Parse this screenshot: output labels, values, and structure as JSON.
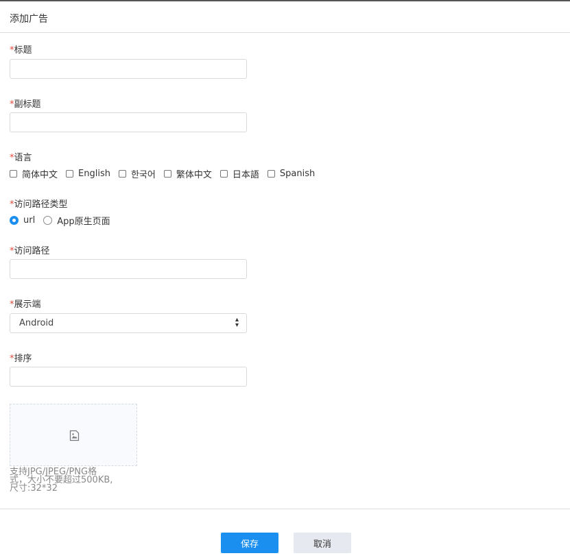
{
  "dialog": {
    "title": "添加广告"
  },
  "form": {
    "required_mark": "*",
    "title": {
      "label": "标题",
      "value": ""
    },
    "subtitle": {
      "label": "副标题",
      "value": ""
    },
    "language": {
      "label": "语言",
      "options": [
        {
          "label": "简体中文",
          "checked": false
        },
        {
          "label": "English",
          "checked": false
        },
        {
          "label": "한국어",
          "checked": false
        },
        {
          "label": "繁体中文",
          "checked": false
        },
        {
          "label": "日本語",
          "checked": false
        },
        {
          "label": "Spanish",
          "checked": false
        }
      ]
    },
    "path_type": {
      "label": "访问路径类型",
      "options": [
        {
          "label": "url",
          "selected": true
        },
        {
          "label": "App原生页面",
          "selected": false
        }
      ]
    },
    "path": {
      "label": "访问路径",
      "value": ""
    },
    "platform": {
      "label": "展示端",
      "value": "Android"
    },
    "sort": {
      "label": "排序",
      "value": ""
    },
    "upload": {
      "hint_line1": "支持JPG/JPEG/PNG格",
      "hint_line2": "式，大小不要超过500KB,",
      "hint_line3": "尺寸:32*32"
    }
  },
  "footer": {
    "save_label": "保存",
    "cancel_label": "取消"
  },
  "colors": {
    "primary": "#1a8ff0",
    "required": "#e8483a",
    "cancel_bg": "#e7e9f0"
  }
}
